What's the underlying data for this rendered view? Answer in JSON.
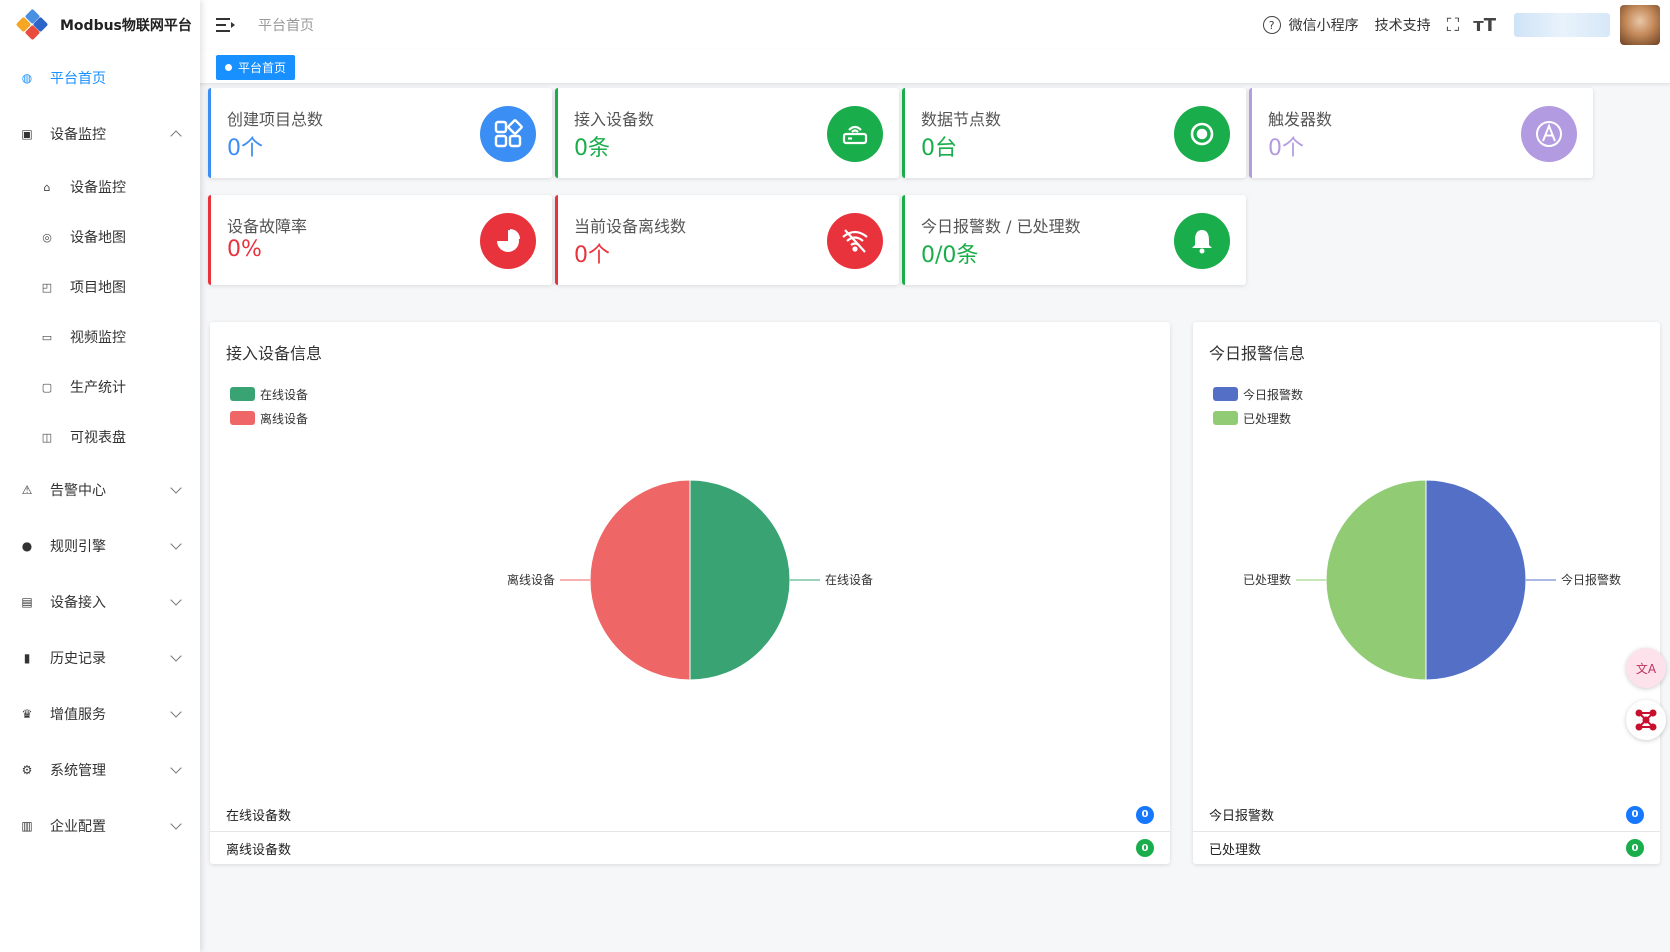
{
  "app": {
    "title": "Modbus物联网平台"
  },
  "header": {
    "breadcrumb": "平台首页",
    "help_icon_glyph": "?",
    "links": [
      "微信小程序",
      "技术支持"
    ],
    "fullscreen_glyph": "⛶",
    "font_glyph": "ᴛT"
  },
  "tabs": [
    {
      "label": "平台首页"
    }
  ],
  "sidebar": {
    "items": [
      {
        "label": "平台首页",
        "icon": "dashboard-icon",
        "active": true
      },
      {
        "label": "设备监控",
        "icon": "monitor-icon",
        "expanded": true,
        "children": [
          {
            "label": "设备监控",
            "icon": "device-icon"
          },
          {
            "label": "设备地图",
            "icon": "map-pin-icon"
          },
          {
            "label": "项目地图",
            "icon": "project-map-icon"
          },
          {
            "label": "视频监控",
            "icon": "video-icon"
          },
          {
            "label": "生产统计",
            "icon": "screen-icon"
          },
          {
            "label": "可视表盘",
            "icon": "board-icon"
          }
        ]
      },
      {
        "label": "告警中心",
        "icon": "alarm-icon"
      },
      {
        "label": "规则引擎",
        "icon": "rule-icon"
      },
      {
        "label": "设备接入",
        "icon": "server-icon"
      },
      {
        "label": "历史记录",
        "icon": "bar-chart-icon"
      },
      {
        "label": "增值服务",
        "icon": "crown-icon"
      },
      {
        "label": "系统管理",
        "icon": "gear-icon"
      },
      {
        "label": "企业配置",
        "icon": "building-icon"
      }
    ]
  },
  "stats": [
    {
      "label": "创建项目总数",
      "value": "0个",
      "color": "#3b8ef3",
      "icon": "apps-icon"
    },
    {
      "label": "接入设备数",
      "value": "0条",
      "color": "#1aad4b",
      "icon": "router-icon"
    },
    {
      "label": "数据节点数",
      "value": "0台",
      "color": "#1aad4b",
      "icon": "node-icon"
    },
    {
      "label": "触发器数",
      "value": "0个",
      "color": "#b29be0",
      "icon": "trigger-icon"
    },
    {
      "label": "设备故障率",
      "value": "0%",
      "color": "#e8333d",
      "icon": "pie-icon"
    },
    {
      "label": "当前设备离线数",
      "value": "0个",
      "color": "#e8333d",
      "icon": "wifi-off-icon"
    },
    {
      "label": "今日报警数 / 已处理数",
      "value": "0/0条",
      "color": "#1aad4b",
      "icon": "bell-icon"
    }
  ],
  "device_panel": {
    "title": "接入设备信息",
    "footer": [
      {
        "label": "在线设备数",
        "count": "0",
        "color": "#1677ff"
      },
      {
        "label": "离线设备数",
        "count": "0",
        "color": "#1aad4b"
      }
    ]
  },
  "alarm_panel": {
    "title": "今日报警信息",
    "footer": [
      {
        "label": "今日报警数",
        "count": "0",
        "color": "#1677ff"
      },
      {
        "label": "已处理数",
        "count": "0",
        "color": "#1aad4b"
      }
    ]
  },
  "chart_data": [
    {
      "type": "pie",
      "series": [
        {
          "name": "在线设备",
          "value": 50,
          "color": "#3aa374"
        },
        {
          "name": "离线设备",
          "value": 50,
          "color": "#ee6666"
        }
      ]
    },
    {
      "type": "pie",
      "series": [
        {
          "name": "今日报警数",
          "value": 50,
          "color": "#5470c6"
        },
        {
          "name": "已处理数",
          "value": 50,
          "color": "#91cc75"
        }
      ]
    }
  ],
  "floating": {
    "translate_glyph": "文A"
  }
}
